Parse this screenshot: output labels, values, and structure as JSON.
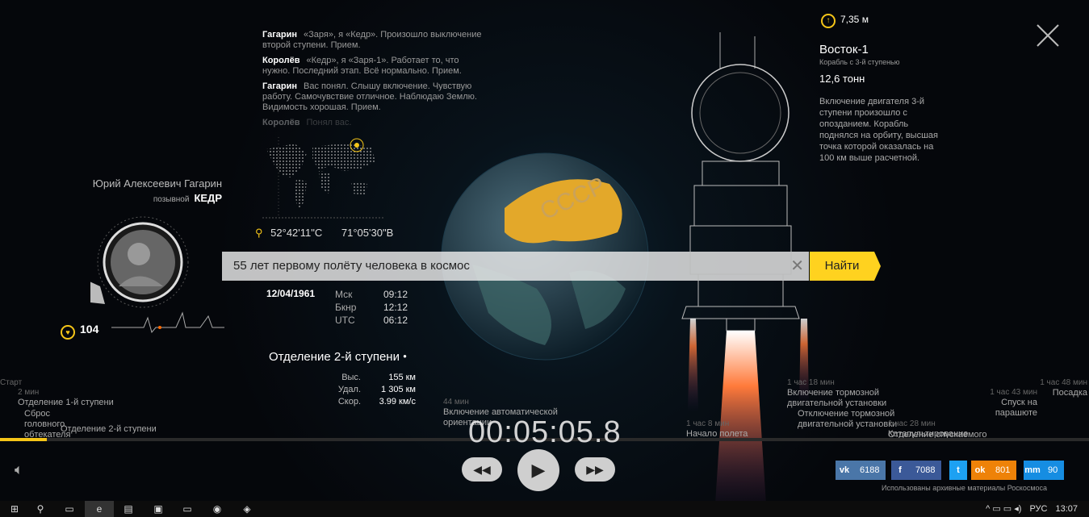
{
  "dialog": [
    {
      "speaker": "Гагарин",
      "text": "«Заря», я «Кедр». Произошло выключение второй ступени. Прием."
    },
    {
      "speaker": "Королёв",
      "text": "«Кедр», я «Заря-1». Работает то, что нужно. Последний этап. Всё нормально. Прием."
    },
    {
      "speaker": "Гагарин",
      "text": "Вас понял. Слышу включение. Чувствую работу. Самочувствие отличное. Наблюдаю Землю. Видимость хорошая. Прием."
    },
    {
      "speaker": "Королёв",
      "text": "Понял вас."
    }
  ],
  "coords": {
    "lat": "52°42'11\"С",
    "lon": "71°05'30\"В"
  },
  "datetime": {
    "date": "12/04/1961",
    "zones": [
      {
        "name": "Мск",
        "time": "09:12"
      },
      {
        "name": "Бкнр",
        "time": "12:12"
      },
      {
        "name": "UTC",
        "time": "06:12"
      }
    ]
  },
  "stage": {
    "title": "Отделение 2-й ступени",
    "stats": [
      {
        "k": "Выс.",
        "v": "155 км"
      },
      {
        "k": "Удал.",
        "v": "1 305 км"
      },
      {
        "k": "Скор.",
        "v": "3.99 км/с"
      }
    ]
  },
  "person": {
    "name": "Юрий Алексеевич Гагарин",
    "callsign_label": "позывной",
    "callsign": "КЕДР",
    "pulse": "104"
  },
  "search": {
    "query": "55 лет первому полёту человека в космос",
    "button": "Найти"
  },
  "globe": {
    "label": "СССР"
  },
  "ship": {
    "height": "7,35 м",
    "name": "Восток-1",
    "subtitle": "Корабль с 3-й ступенью",
    "mass": "12,6 тонн",
    "description": "Включение двигателя 3-й ступени произошло с опозданием. Корабль поднялся на орбиту, высшая точка которой оказалась на 100 км выше расчетной."
  },
  "timeline": {
    "events": [
      {
        "time": "Старт",
        "label": ""
      },
      {
        "time": "2 мин",
        "label": "Отделение 1-й ступени"
      },
      {
        "time": "",
        "label": "Сброс головного обтекателя"
      },
      {
        "time": "",
        "label": "Отделение 2-й ступени"
      },
      {
        "time": "44 мин",
        "label": "Включение автоматической ориентации"
      },
      {
        "time": "1 час 8 мин",
        "label": "Начало полета"
      },
      {
        "time": "1 час 18 мин",
        "label": "Включение тормозной двигательной установки"
      },
      {
        "time": "",
        "label": "Отключение тормозной двигательной установки"
      },
      {
        "time": "1 час 28 мин",
        "label": "Катапультирование"
      },
      {
        "time": "",
        "label": "Отделение спускаемого"
      },
      {
        "time": "1 час 43 мин",
        "label": "Спуск на парашюте"
      },
      {
        "time": "1 час 48 мин",
        "label": "Посадка"
      }
    ],
    "clock": "00:05:05.8",
    "progress": 0.043
  },
  "controls": {
    "rewind": "◀◀",
    "play": "▶",
    "forward": "▶▶"
  },
  "social": [
    {
      "logo": "vk",
      "count": "6188",
      "color": "#4a76a8"
    },
    {
      "logo": "f",
      "count": "7088",
      "color": "#3b5998"
    },
    {
      "logo": "t",
      "count": "",
      "color": "#1da1f2"
    },
    {
      "logo": "ok",
      "count": "801",
      "color": "#ee8208"
    },
    {
      "logo": "mm",
      "count": "90",
      "color": "#168de2"
    }
  ],
  "credit": "Использованы архивные материалы Роскосмоса",
  "taskbar": {
    "lang": "РУС",
    "time": "13:07"
  }
}
